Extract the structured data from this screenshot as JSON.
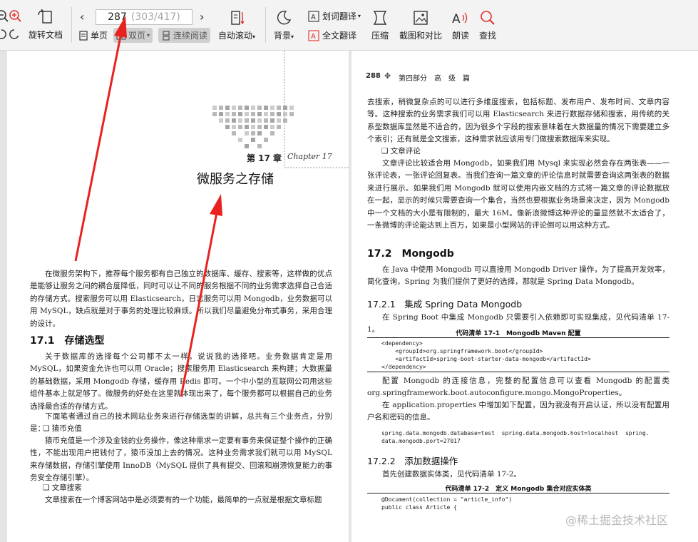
{
  "toolbar": {
    "rotate_label": "旋转文档",
    "page_current": "287",
    "page_total": "(303/417)",
    "single_label": "单页",
    "double_label": "双页",
    "continuous_label": "连续阅读",
    "autoscroll_label": "自动滚动",
    "background_label": "背景",
    "word_translate_label": "划词翻译",
    "full_translate_label": "全文翻译",
    "compress_label": "压缩",
    "screenshot_label": "截图和对比",
    "read_aloud_label": "朗读",
    "search_label": "查找"
  },
  "left_page": {
    "chapter_num": "第 17 章",
    "chapter_script": "Chapter 17",
    "chapter_title": "微服务之存储",
    "intro": "在微服务架构下，推荐每个服务都有自己独立的数据库、缓存、搜索等，这样做的优点是能够让服务之间的耦合度降低，同时可以让不同的服务根据不同的业务需求选择自己合适的存储方式。搜索服务可以用 Elasticsearch，日志服务可以用 Mongodb，业务数据可以用 MySQL，缺点就是对于事务的处理比较麻烦。所以我们尽量避免分布式事务，采用合理的设计。",
    "section_title": "17.1　存储选型",
    "p1": "关于数据库的选择每个公司都不太一样，说说我的选择吧。业务数据肯定是用 MySQL，如果资金允许也可以用 Oracle；搜索服务用 Elasticsearch 来构建；大数据量的基础数据，采用 Mongodb 存储，缓存用 Redis 即可。一个中小型的互联网公司用这些组件基本上就足够了。微服务的好处在这里就体现出来了，每个服务都可以根据自己的业务选择最合适的存储方式。",
    "p2": "下面笔者通过自己的技术网站业务来进行存储选型的讲解，总共有三个业务点，分别是：",
    "b1": "❑ 猿币充值",
    "p3": "猿币充值是一个涉及金钱的业务操作，像这种需求一定要有事务来保证整个操作的正确性，不能出现用户把钱付了，猿币没加上去的情况。这种业务需求我们就可以用 MySQL 来存储数据，存储引擎使用 InnoDB（MySQL 提供了具有提交、回滚和崩溃恢复能力的事务安全存储引擎）。",
    "b2": "❑ 文章搜索",
    "p4": "文章搜索在一个博客网站中是必须要有的一个功能，最简单的一点就是根据文章标题"
  },
  "right_page": {
    "header_num": "288",
    "header_text": "第四部分　高　级　篇",
    "p1": "去搜索，稍微复杂点的可以进行多维度搜索，包括标题、发布用户、发布时间、文章内容等。这种搜索的业务需求我们可以用 Elasticsearch 来进行数据存储和搜索，用传统的关系型数据库显然是不适合的，因为很多个字段的搜索意味着在大数据量的情况下需要建立多个索引；还有就是全文搜索，这种需求就应该用专门做搜索数据库来实现。",
    "b1": "❑ 文章评论",
    "p2": "文章评论比较适合用 Mongodb，如果我们用 Mysql 来实现必然会存在两张表——一张评论表，一张评论回复表。当我们查询一篇文章的评论信息时就需要查询这两张表的数据来进行展示。如果我们用 Mongodb 就可以使用内嵌文档的方式将一篇文章的评论数据放在一起，显示的时候只需要查询一个集合，当然也要根据业务场景来决定，因为 Mongodb 中一个文档的大小是有限制的，最大 16M。像新浪微博这种评论的量显然就不太适合了，一条微博的评论能达到上百万，如果是小型网站的评论倒可以用这种方式。",
    "s1_title": "17.2　Mongodb",
    "p3": "在 Java 中使用 Mongodb 可以直接用 Mongodb Driver 操作，为了提高开发效率，简化查询，Spring 为我们提供了更好的选择，那就是 Spring Data Mongodb。",
    "s2_title": "17.2.1　集成 Spring Data Mongodb",
    "p4": "在 Spring Boot 中集成 Mongodb 只需要引入依赖即可实现集成，见代码清单 17-1。",
    "cap1": "代码清单 17-1　Mongodb Maven 配置",
    "code1": "<dependency>\n    <groupId>org.springframework.boot</groupId>\n    <artifactId>spring-boot-starter-data-mongodb</artifactId>\n</dependency>",
    "p5": "配置 Mongodb 的连接信息，完整的配置信息可以查看 Mongodb 的配置类 org.springframework.boot.autoconfigure.mongo.MongoProperties。",
    "p6": "在 application.properties 中增加如下配置，因为我没有开启认证，所以没有配置用户名和密码的信息。",
    "code2": "spring.data.mongodb.database=test  spring.data.mongodb.host=localhost  spring.\ndata.mongodb.port=27017",
    "s3_title": "17.2.2　添加数据操作",
    "p7": "首先创建数据实体类，见代码清单 17-2。",
    "cap2": "代码清单 17-2　定义 Mongodb 集合对应实体类",
    "code3": "@Document(collection = \"article_info\")\npublic class Article {",
    "watermark": "@稀土掘金技术社区"
  },
  "colors": {
    "arrow": "#e8231f",
    "icon": "#333333",
    "search_icon": "#e0302b"
  }
}
